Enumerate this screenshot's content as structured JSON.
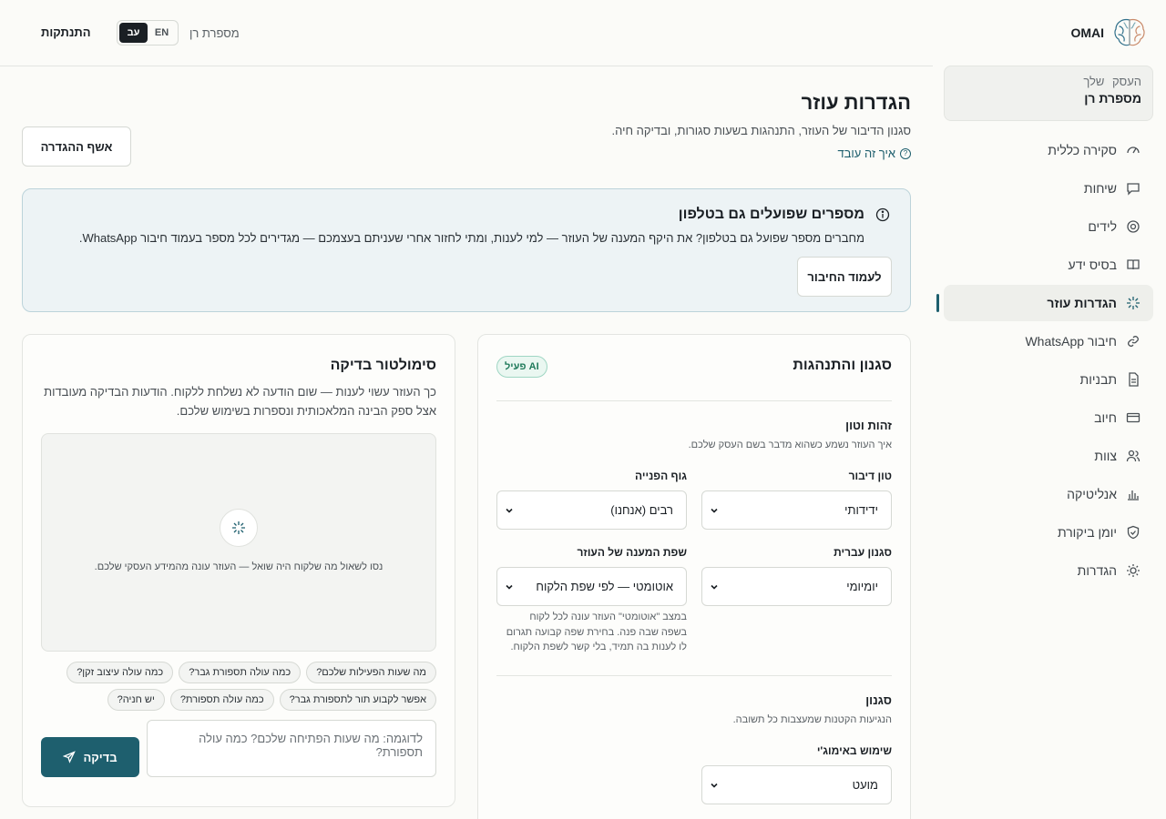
{
  "brand": {
    "name": "OMAI"
  },
  "business": {
    "label": "העסק שלך",
    "name": "מספרת רן"
  },
  "nav": [
    {
      "label": "סקירה כללית",
      "icon": "gauge-icon"
    },
    {
      "label": "שיחות",
      "icon": "chat-icon"
    },
    {
      "label": "לידים",
      "icon": "target-icon"
    },
    {
      "label": "בסיס ידע",
      "icon": "book-icon"
    },
    {
      "label": "הגדרות עוזר",
      "icon": "sparkle-icon",
      "active": true
    },
    {
      "label": "חיבור WhatsApp",
      "icon": "link-icon"
    },
    {
      "label": "תבניות",
      "icon": "document-icon"
    },
    {
      "label": "חיוב",
      "icon": "credit-card-icon"
    },
    {
      "label": "צוות",
      "icon": "users-icon"
    },
    {
      "label": "אנליטיקה",
      "icon": "bar-chart-icon"
    },
    {
      "label": "יומן ביקורת",
      "icon": "shield-icon"
    },
    {
      "label": "הגדרות",
      "icon": "sun-gear-icon"
    }
  ],
  "topbar": {
    "logout": "התנתקות",
    "lang_he": "עב",
    "lang_en": "EN",
    "business_name": "מספרת רן"
  },
  "page": {
    "title": "הגדרות עוזר",
    "subtitle": "סגנון הדיבור של העוזר, התנהגות בשעות סגורות, ובדיקה חיה.",
    "how_link": "איך זה עובד",
    "reset_button": "אשף ההגדרה"
  },
  "banner": {
    "title": "מספרים שפועלים גם בטלפון",
    "text": "מחברים מספר שפועל גם בטלפון? את היקף המענה של העוזר — למי לענות, ומתי לחזור אחרי שעניתם בעצמכם — מגדירים לכל מספר בעמוד חיבור WhatsApp.",
    "button": "לעמוד החיבור"
  },
  "style_card": {
    "title": "סגנון והתנהגות",
    "badge": "AI פעיל",
    "identity_title": "זהות וטון",
    "identity_sub": "איך העוזר נשמע כשהוא מדבר בשם העסק שלכם.",
    "tone_label": "טון דיבור",
    "tone_value": "ידידותי",
    "person_label": "גוף הפנייה",
    "person_value": "רבים (אנחנו)",
    "hebrew_label": "סגנון עברית",
    "hebrew_value": "יומיומי",
    "lang_label": "שפת המענה של העוזר",
    "lang_value": "אוטומטי — לפי שפת הלקוח",
    "lang_help": "במצב \"אוטומטי\" העוזר עונה לכל לקוח בשפה שבה פנה. בחירת שפה קבועה תגרום לו לענות בה תמיד, בלי קשר לשפת הלקוח.",
    "style_title": "סגנון",
    "style_sub": "הנגיעות הקטנות שמעצבות כל תשובה.",
    "emoji_label": "שימוש באימוג'י",
    "emoji_value": "מועט"
  },
  "simulator": {
    "title": "סימולטור בדיקה",
    "description": "כך העוזר עשוי לענות — שום הודעה לא נשלחת ללקוח. הודעות הבדיקה מעובדות אצל ספק הבינה המלאכותית ונספרות בשימוש שלכם.",
    "empty": "נסו לשאול מה שלקוח היה שואל — העוזר עונה מהמידע העסקי שלכם.",
    "chips": [
      "מה שעות הפעילות שלכם?",
      "כמה עולה תספורת גבר?",
      "כמה עולה עיצוב זקן?",
      "אפשר לקבוע תור לתספורת גבר?",
      "כמה עולה תספורת?",
      "יש חניה?"
    ],
    "placeholder": "לדוגמה: מה שעות הפתיחה שלכם? כמה עולה תספורת?",
    "button": "בדיקה"
  }
}
